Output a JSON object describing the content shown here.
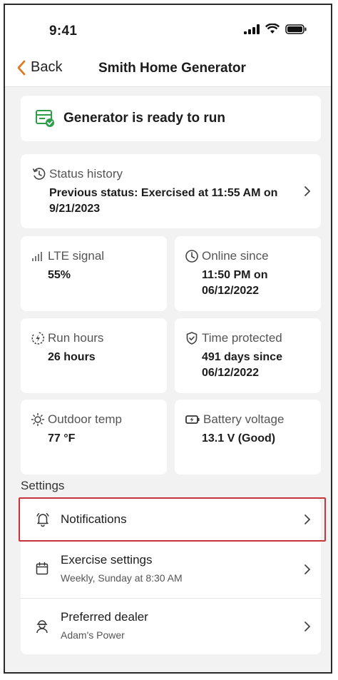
{
  "status_bar": {
    "time": "9:41"
  },
  "nav": {
    "back_label": "Back",
    "title": "Smith Home Generator"
  },
  "ready_card": {
    "text": "Generator is ready to run"
  },
  "history": {
    "label": "Status history",
    "value": "Previous status: Exercised at 11:55 AM on 9/21/2023"
  },
  "tiles": {
    "lte": {
      "label": "LTE signal",
      "value": "55%"
    },
    "online": {
      "label": "Online since",
      "value": "11:50 PM on 06/12/2022"
    },
    "run_hours": {
      "label": "Run hours",
      "value": "26 hours"
    },
    "protected": {
      "label": "Time protected",
      "value": "491 days since 06/12/2022"
    },
    "temp": {
      "label": "Outdoor temp",
      "value": "77 °F"
    },
    "battery": {
      "label": "Battery voltage",
      "value": "13.1 V (Good)"
    }
  },
  "settings": {
    "heading": "Settings",
    "notifications": {
      "title": "Notifications"
    },
    "exercise": {
      "title": "Exercise settings",
      "subtitle": "Weekly, Sunday at 8:30 AM"
    },
    "dealer": {
      "title": "Preferred dealer",
      "subtitle": "Adam's Power"
    }
  },
  "colors": {
    "accent_orange": "#e07a1f",
    "check_green": "#2e9e4a",
    "highlight_red": "#c8343c"
  }
}
